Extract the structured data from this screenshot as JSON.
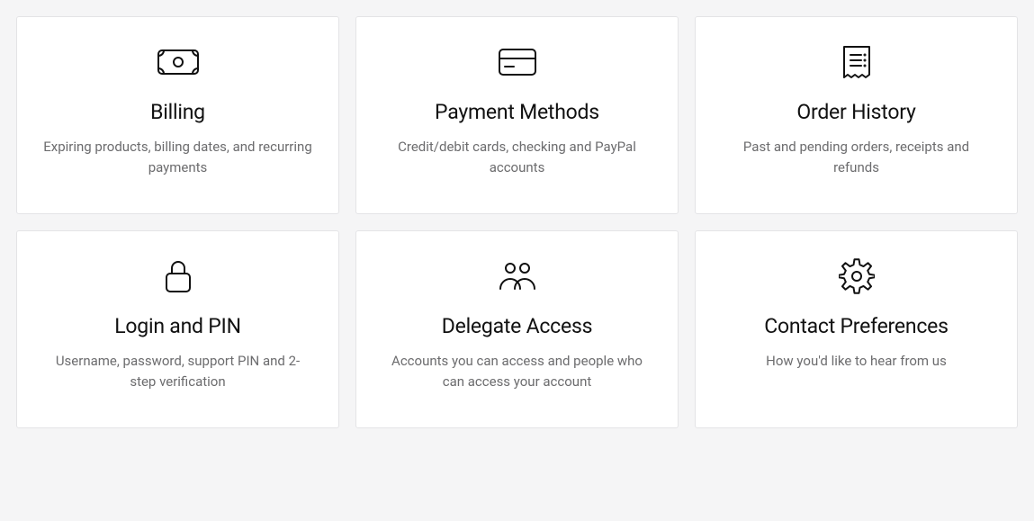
{
  "cards": [
    {
      "title": "Billing",
      "desc": "Expiring products, billing dates, and recurring payments"
    },
    {
      "title": "Payment Methods",
      "desc": "Credit/debit cards, checking and PayPal accounts"
    },
    {
      "title": "Order History",
      "desc": "Past and pending orders, receipts and refunds"
    },
    {
      "title": "Login and PIN",
      "desc": "Username, password, support PIN and 2-step verification"
    },
    {
      "title": "Delegate Access",
      "desc": "Accounts you can access and people who can access your account"
    },
    {
      "title": "Contact Preferences",
      "desc": "How you'd like to hear from us"
    }
  ]
}
